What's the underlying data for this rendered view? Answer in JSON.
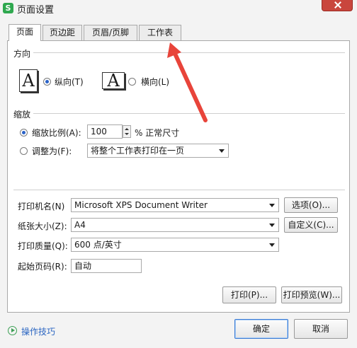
{
  "window": {
    "title": "页面设置",
    "app_icon": "S"
  },
  "tabs": [
    {
      "label": "页面",
      "active": true
    },
    {
      "label": "页边距",
      "active": false
    },
    {
      "label": "页眉/页脚",
      "active": false
    },
    {
      "label": "工作表",
      "active": false
    }
  ],
  "orientation": {
    "group_label": "方向",
    "portrait_glyph": "A",
    "portrait_label": "纵向(T)",
    "landscape_glyph": "A",
    "landscape_label": "横向(L)",
    "selected": "portrait"
  },
  "scaling": {
    "group_label": "缩放",
    "scale_label": "缩放比例(A):",
    "scale_value": "100",
    "scale_suffix": "% 正常尺寸",
    "fit_label": "调整为(F):",
    "fit_option": "将整个工作表打印在一页",
    "selected": "scale"
  },
  "printer": {
    "printer_label": "打印机名(N)",
    "printer_value": "Microsoft XPS Document Writer",
    "options_button": "选项(O)...",
    "paper_label": "纸张大小(Z):",
    "paper_value": "A4",
    "custom_button": "自定义(C)...",
    "quality_label": "打印质量(Q):",
    "quality_value": "600 点/英寸",
    "start_page_label": "起始页码(R):",
    "start_page_value": "自动"
  },
  "actions": {
    "print_button": "打印(P)...",
    "preview_button": "打印预览(W)...",
    "ok_button": "确定",
    "cancel_button": "取消",
    "help_link": "操作技巧"
  },
  "colors": {
    "annotation_arrow": "#e8443a",
    "close_button": "#c9463d",
    "app_icon": "#2fa84f",
    "link": "#2b66c2"
  }
}
